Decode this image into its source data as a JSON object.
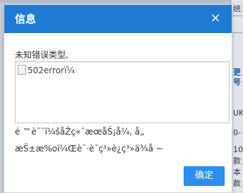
{
  "dialog": {
    "title": "信息",
    "close_icon": "×",
    "message_label": "未知错误类型,",
    "image_alt": "502errorï¼",
    "garbled_line_1": "é ™è¯¯ï¼šåŽç«¯æœåŠ¡å¼, å„",
    "garbled_line_2": "æŠ±æ%oï¼Œè¯·è¯ç³»è¿ç³»ä¾å     ~",
    "ok_label": "确定"
  },
  "background": {
    "cells": [
      "统",
      "",
      "",
      "",
      "",
      "更",
      "号",
      "",
      "UK",
      "0-",
      "10",
      "款",
      "本",
      "款"
    ]
  }
}
